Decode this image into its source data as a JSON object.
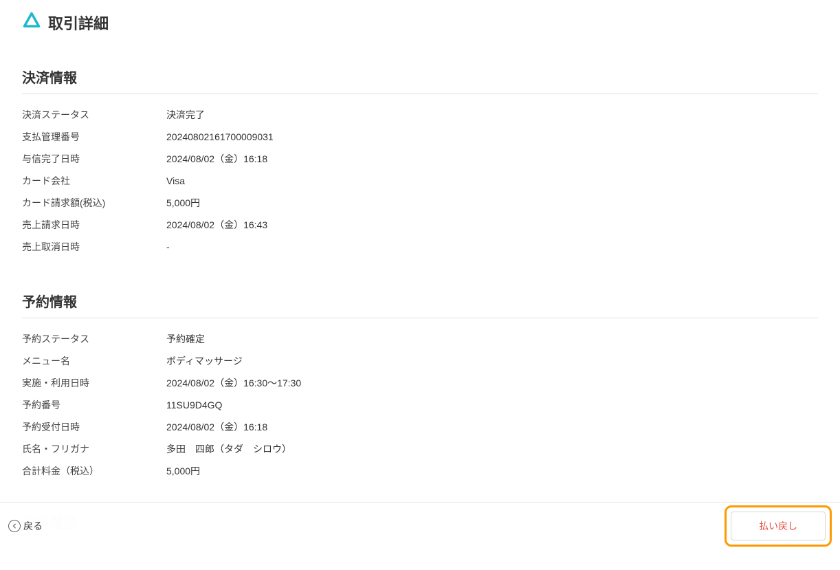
{
  "header": {
    "title": "取引詳細",
    "iconColor": "#1eb8d0"
  },
  "paymentInfo": {
    "sectionTitle": "決済情報",
    "rows": [
      {
        "label": "決済ステータス",
        "value": "決済完了"
      },
      {
        "label": "支払管理番号",
        "value": "20240802161700009031"
      },
      {
        "label": "与信完了日時",
        "value": "2024/08/02（金）16:18"
      },
      {
        "label": "カード会社",
        "value": "Visa"
      },
      {
        "label": "カード請求額(税込)",
        "value": "5,000円"
      },
      {
        "label": "売上請求日時",
        "value": "2024/08/02（金）16:43"
      },
      {
        "label": "売上取消日時",
        "value": "-"
      }
    ]
  },
  "bookingInfo": {
    "sectionTitle": "予約情報",
    "rows": [
      {
        "label": "予約ステータス",
        "value": "予約確定"
      },
      {
        "label": "メニュー名",
        "value": "ボディマッサージ"
      },
      {
        "label": "実施・利用日時",
        "value": "2024/08/02（金）16:30〜17:30"
      },
      {
        "label": "予約番号",
        "value": "11SU9D4GQ"
      },
      {
        "label": "予約受付日時",
        "value": "2024/08/02（金）16:18"
      },
      {
        "label": "氏名・フリガナ",
        "value": "多田　四郎（タダ　シロウ）"
      },
      {
        "label": "合計料金（税込）",
        "value": "5,000円"
      }
    ]
  },
  "fadedSection": {
    "title": "決済履歴"
  },
  "footer": {
    "backLabel": "戻る",
    "refundLabel": "払い戻し"
  }
}
